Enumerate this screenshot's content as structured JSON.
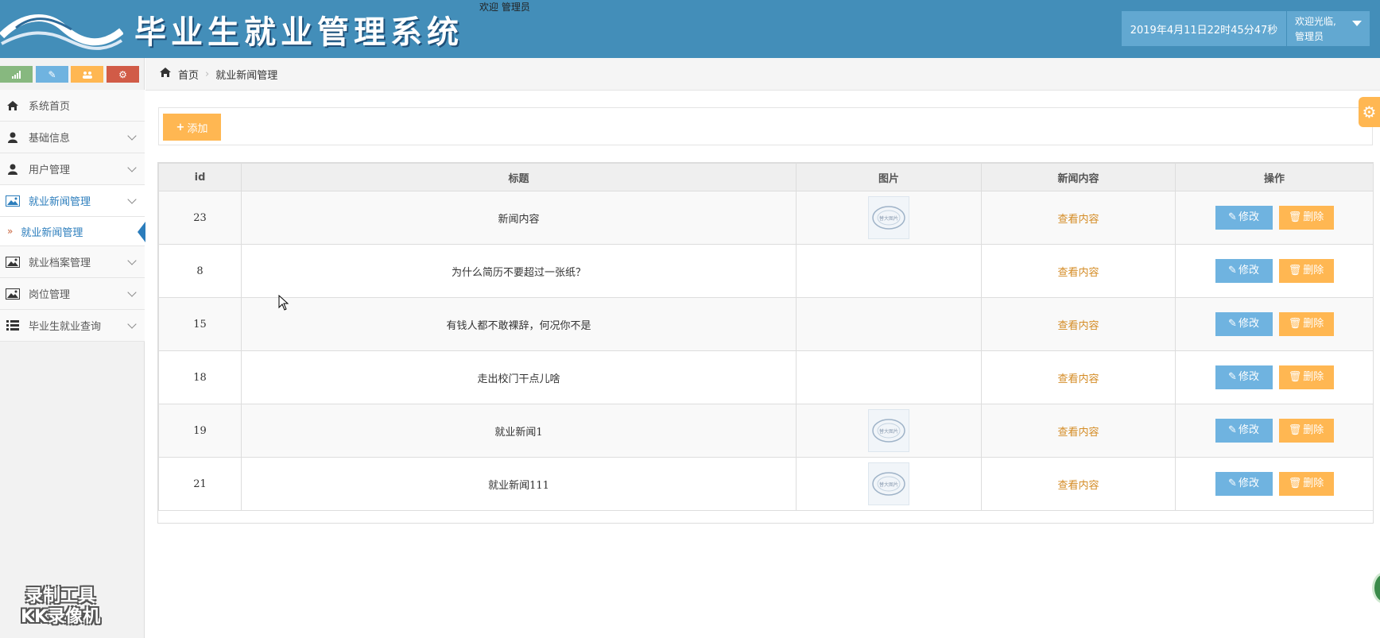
{
  "header": {
    "logo_text": "毕业生就业管理系统",
    "welcome_top": "欢迎 管理员",
    "datetime": "2019年4月11日22时45分47秒",
    "user_greeting": "欢迎光临,",
    "user_name": "管理员",
    "colors": {
      "bar": "#438eb9",
      "box": "#62a8d1"
    }
  },
  "sidebar": {
    "shortcuts": [
      {
        "icon": "signal-icon",
        "color": "#87b87f"
      },
      {
        "icon": "pencil-icon",
        "color": "#6fb3e0"
      },
      {
        "icon": "group-icon",
        "color": "#ffb752"
      },
      {
        "icon": "cogs-icon",
        "color": "#d15b47"
      }
    ],
    "items": [
      {
        "label": "系统首页",
        "icon": "home-icon"
      },
      {
        "label": "基础信息",
        "icon": "user-icon"
      },
      {
        "label": "用户管理",
        "icon": "user-icon"
      },
      {
        "label": "就业新闻管理",
        "icon": "picture-icon"
      },
      {
        "label": "就业档案管理",
        "icon": "picture-icon"
      },
      {
        "label": "岗位管理",
        "icon": "picture-icon"
      },
      {
        "label": "毕业生就业查询",
        "icon": "list-icon"
      }
    ],
    "sub_item": "就业新闻管理"
  },
  "breadcrumb": {
    "home": "首页",
    "current": "就业新闻管理"
  },
  "toolbar": {
    "add_label": "添加"
  },
  "table": {
    "headers": [
      "id",
      "标题",
      "图片",
      "新闻内容",
      "操作"
    ],
    "view_label": "查看内容",
    "edit_label": "修改",
    "delete_label": "删除",
    "thumb_label": "替大图片",
    "rows": [
      {
        "id": "23",
        "title": "新闻内容",
        "has_image": true
      },
      {
        "id": "8",
        "title": "为什么简历不要超过一张纸？",
        "has_image": false
      },
      {
        "id": "15",
        "title": "有钱人都不敢裸辞，何况你不是",
        "has_image": false
      },
      {
        "id": "18",
        "title": "走出校门干点儿啥",
        "has_image": false
      },
      {
        "id": "19",
        "title": "就业新闻1",
        "has_image": true
      },
      {
        "id": "21",
        "title": "就业新闻111",
        "has_image": true
      }
    ]
  },
  "watermark": {
    "line1": "录制工具",
    "line2": "KK录像机"
  }
}
